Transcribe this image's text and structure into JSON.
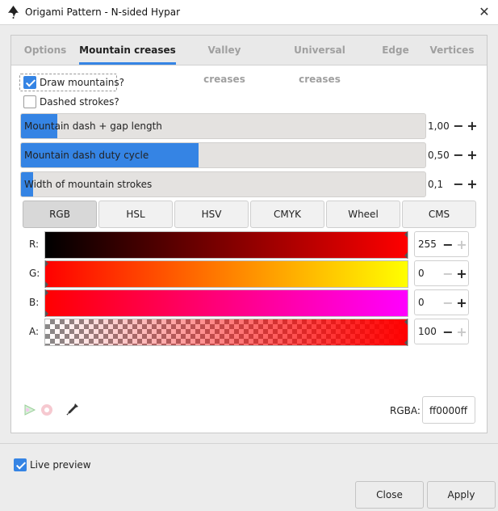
{
  "window": {
    "title": "Origami Pattern - N-sided Hypar",
    "close_icon": "close-icon"
  },
  "tabs": [
    {
      "label": "Options",
      "active": false
    },
    {
      "label": "Mountain creases",
      "active": true
    },
    {
      "label": "Valley creases",
      "active": false
    },
    {
      "label": "Universal creases",
      "active": false
    },
    {
      "label": "Edge",
      "active": false
    },
    {
      "label": "Vertices",
      "active": false
    }
  ],
  "options": {
    "draw_mountains": {
      "label": "Draw mountains?",
      "checked": true
    },
    "dashed_strokes": {
      "label": "Dashed strokes?",
      "checked": false
    }
  },
  "spinbuttons": [
    {
      "label": "Mountain dash + gap length",
      "value": "1,00",
      "fill_fraction": 0.09
    },
    {
      "label": "Mountain dash duty cycle",
      "value": "0,50",
      "fill_fraction": 0.44
    },
    {
      "label": "Width of mountain strokes",
      "value": "0,1",
      "fill_fraction": 0.03
    }
  ],
  "color_modes": [
    "RGB",
    "HSL",
    "HSV",
    "CMYK",
    "Wheel",
    "CMS"
  ],
  "active_color_mode": "RGB",
  "channels": [
    {
      "label": "R:",
      "value": "255",
      "level": 1.0
    },
    {
      "label": "G:",
      "value": "0",
      "level": 0.0
    },
    {
      "label": "B:",
      "value": "0",
      "level": 0.0
    },
    {
      "label": "A:",
      "value": "100",
      "level": 1.0
    }
  ],
  "icons": {
    "color_managed": "color-managed-icon",
    "out_of_gamut": "out-of-gamut-icon",
    "picker": "eyedropper-icon"
  },
  "rgba": {
    "label": "RGBA:",
    "value": "ff0000ff"
  },
  "live_preview": {
    "label": "Live preview",
    "checked": true
  },
  "buttons": {
    "close": "Close",
    "apply": "Apply"
  },
  "colors": {
    "accent": "#3584e4",
    "selected": "#ff0000"
  }
}
